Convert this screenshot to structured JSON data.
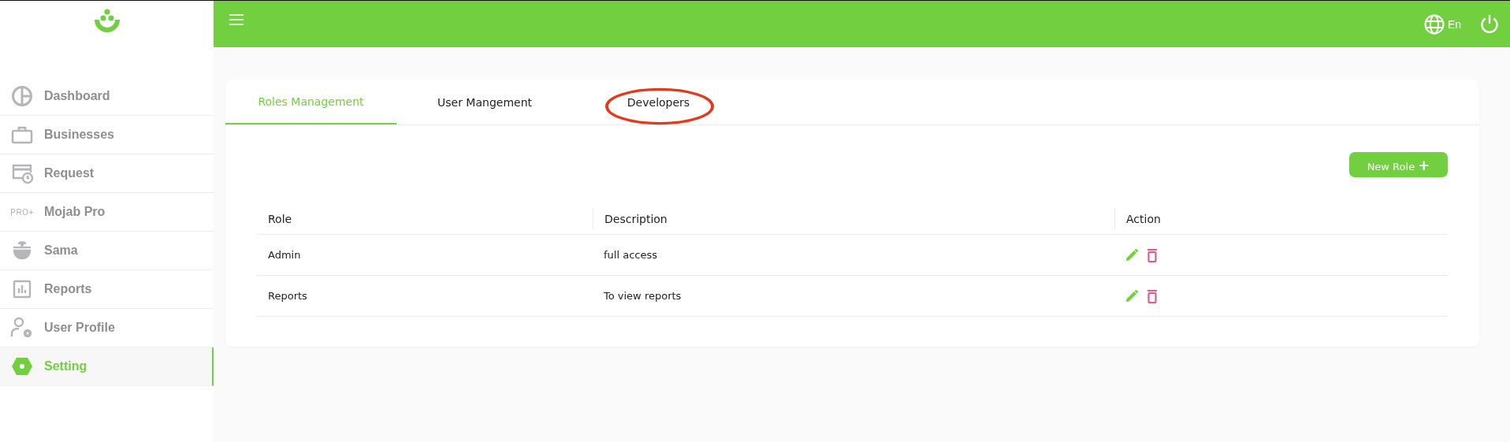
{
  "top_bar": {
    "language": "En"
  },
  "sidebar": {
    "items": [
      {
        "label": "Dashboard",
        "selected": false
      },
      {
        "label": "Businesses",
        "selected": false
      },
      {
        "label": "Request",
        "selected": false
      },
      {
        "label": "Mojab Pro",
        "selected": false,
        "badge": "PRO+"
      },
      {
        "label": "Sama",
        "selected": false
      },
      {
        "label": "Reports",
        "selected": false
      },
      {
        "label": "User Profile",
        "selected": false
      },
      {
        "label": "Setting",
        "selected": true
      }
    ]
  },
  "tabs": [
    {
      "label": "Roles Management",
      "selected": true,
      "circled": false
    },
    {
      "label": "User Mangement",
      "selected": false,
      "circled": false
    },
    {
      "label": "Developers",
      "selected": false,
      "circled": true
    }
  ],
  "new_role_button": {
    "label": "New Role",
    "icon_text": "+"
  },
  "table": {
    "columns": [
      "Role",
      "Description",
      "Action"
    ],
    "rows": [
      {
        "role": "Admin",
        "description": "full access"
      },
      {
        "role": "Reports",
        "description": "To view reports"
      }
    ]
  }
}
